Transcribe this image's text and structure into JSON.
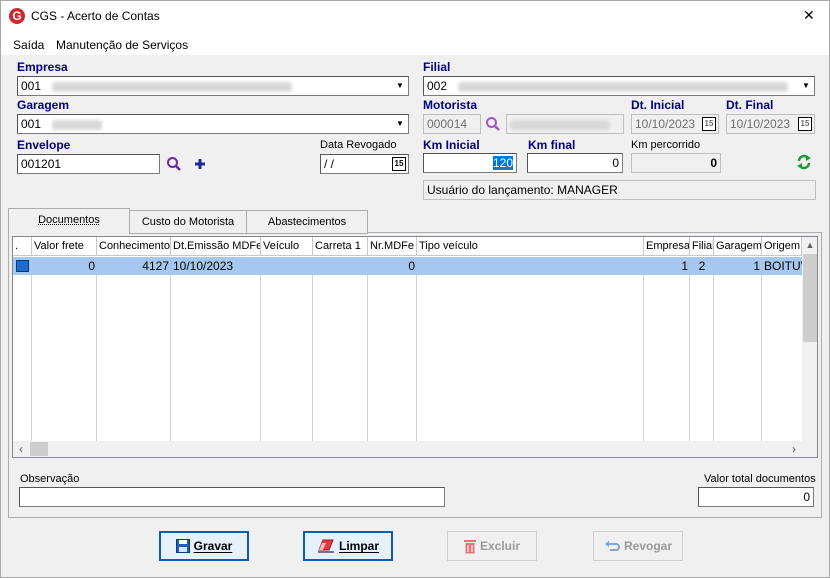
{
  "window": {
    "title": "CGS - Acerto de Contas",
    "close_glyph": "✕",
    "logo_letter": "G",
    "accent": "#d0262c"
  },
  "menu": [
    "Saída",
    "Manutenção de Serviços"
  ],
  "form": {
    "empresa_label": "Empresa",
    "empresa_value": "001",
    "filial_label": "Filial",
    "filial_value": "002",
    "garagem_label": "Garagem",
    "garagem_value": "001",
    "motorista_label": "Motorista",
    "motorista_value": "000014",
    "dt_inicial_label": "Dt. Inicial",
    "dt_inicial_value": "10/10/2023",
    "dt_final_label": "Dt. Final",
    "dt_final_value": "10/10/2023",
    "envelope_label": "Envelope",
    "envelope_value": "001201",
    "data_revogado_label": "Data Revogado",
    "data_revogado_value": " /  /",
    "km_inicial_label": "Km Inicial",
    "km_inicial_value": "120",
    "km_final_label": "Km final",
    "km_final_value": "0",
    "km_percorrido_label": "Km percorrido",
    "km_percorrido_value": "0",
    "usuario_text": "Usuário do lançamento: MANAGER",
    "calendar_glyph": "15"
  },
  "tabs": [
    "Documentos",
    "Custo do Motorista",
    "Abastecimentos"
  ],
  "grid": {
    "columns": [
      ".",
      "Valor frete",
      "Conhecimento",
      "Dt.Emissão MDFe",
      "Veículo",
      "Carreta 1",
      "Nr.MDFe",
      "Tipo veículo",
      "Empresa",
      "Filial",
      "Garagem",
      "Origem"
    ],
    "rows": [
      [
        "",
        "0",
        "4127",
        "10/10/2023",
        "",
        "",
        "0",
        "",
        "1",
        "2",
        "1",
        "BOITUV"
      ]
    ],
    "selection_color": "#a6c8f0"
  },
  "footer": {
    "observacao_label": "Observação",
    "observacao_value": "",
    "valor_total_label": "Valor total documentos",
    "valor_total_value": "0"
  },
  "buttons": {
    "gravar": "Gravar",
    "limpar": "Limpar",
    "excluir": "Excluir",
    "revogar": "Revogar"
  }
}
